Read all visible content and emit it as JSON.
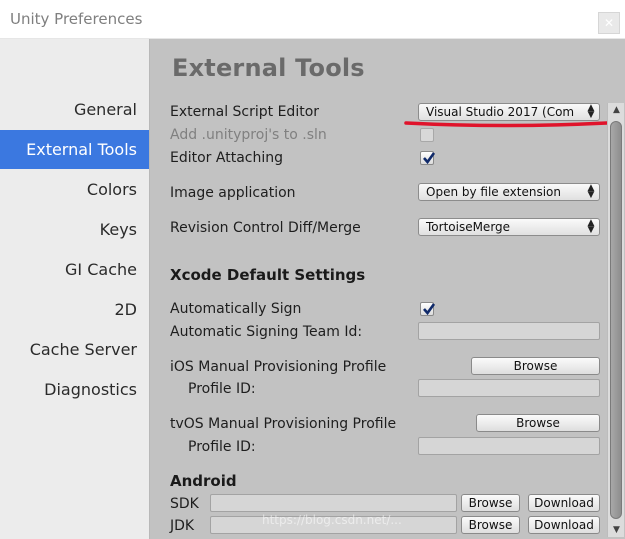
{
  "window": {
    "title": "Unity Preferences"
  },
  "sidebar": {
    "items": [
      {
        "label": "General"
      },
      {
        "label": "External Tools",
        "selected": true
      },
      {
        "label": "Colors"
      },
      {
        "label": "Keys"
      },
      {
        "label": "GI Cache"
      },
      {
        "label": "2D"
      },
      {
        "label": "Cache Server"
      },
      {
        "label": "Diagnostics"
      }
    ],
    "selected_color": "#3b78e0"
  },
  "main": {
    "heading": "External Tools",
    "external_script_editor": {
      "label": "External Script Editor",
      "value": "Visual Studio 2017 (Com"
    },
    "add_unityproj": {
      "label": "Add .unityproj's to .sln",
      "checked": false,
      "disabled": true
    },
    "editor_attaching": {
      "label": "Editor Attaching",
      "checked": true
    },
    "image_application": {
      "label": "Image application",
      "value": "Open by file extension"
    },
    "revision_control": {
      "label": "Revision Control Diff/Merge",
      "value": "TortoiseMerge"
    },
    "xcode": {
      "section_title": "Xcode Default Settings",
      "auto_sign": {
        "label": "Automatically Sign",
        "checked": true
      },
      "team_id": {
        "label": "Automatic Signing Team Id:",
        "value": ""
      },
      "ios_profile": {
        "label": "iOS Manual Provisioning Profile",
        "browse": "Browse",
        "id_label": "Profile ID:",
        "id_value": ""
      },
      "tvos_profile": {
        "label": "tvOS Manual Provisioning Profile",
        "browse": "Browse",
        "id_label": "Profile ID:",
        "id_value": ""
      }
    },
    "android": {
      "section_title": "Android",
      "sdk": {
        "label": "SDK",
        "value": "",
        "browse": "Browse",
        "download": "Download"
      },
      "jdk": {
        "label": "JDK",
        "value": "",
        "browse": "Browse",
        "download": "Download"
      }
    }
  },
  "annotation_color": "#e0132b",
  "watermark": "https://blog.csdn.net/..."
}
